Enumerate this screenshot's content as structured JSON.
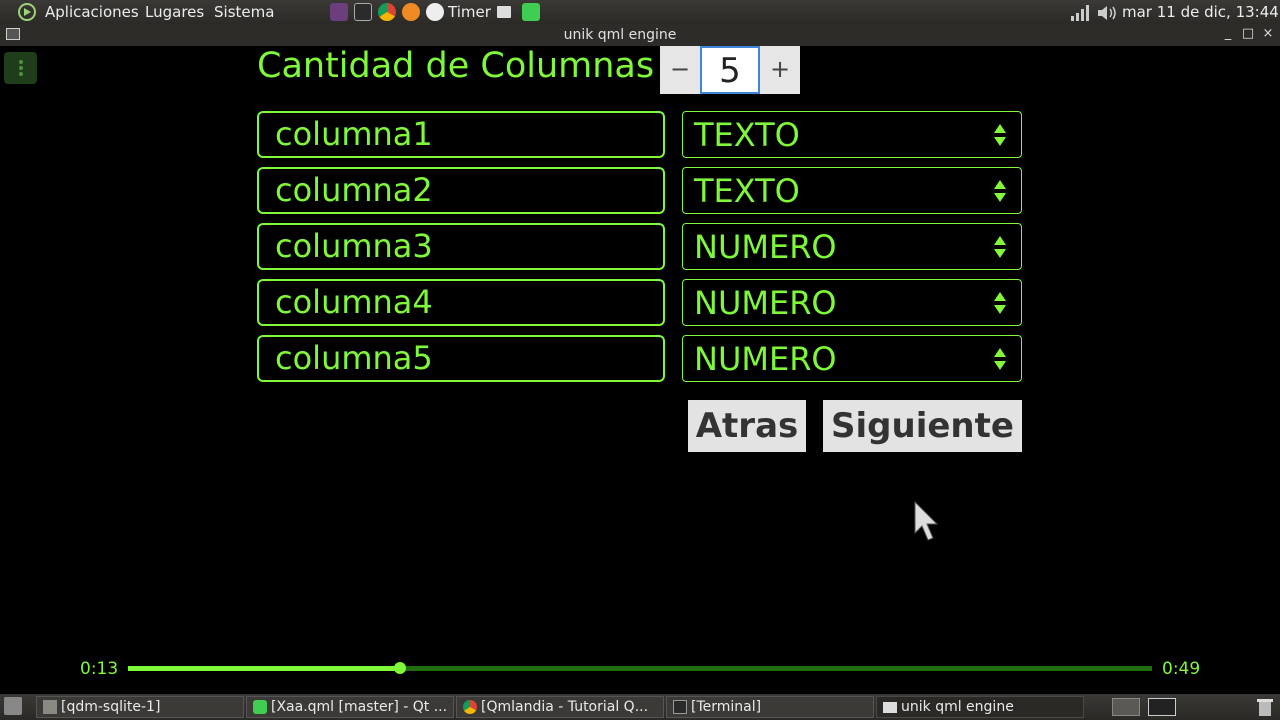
{
  "top_panel": {
    "menus": [
      "Aplicaciones",
      "Lugares",
      "Sistema"
    ],
    "timer_label": "Timer",
    "clock": "mar 11 de dic, 13:44"
  },
  "window": {
    "title": "unik qml engine"
  },
  "form": {
    "heading": "Cantidad de Columnas",
    "count": {
      "minus": "−",
      "value": "5",
      "plus": "+"
    },
    "rows": [
      {
        "name": "columna1",
        "type": "TEXTO"
      },
      {
        "name": "columna2",
        "type": "TEXTO"
      },
      {
        "name": "columna3",
        "type": "NUMERO"
      },
      {
        "name": "columna4",
        "type": "NUMERO"
      },
      {
        "name": "columna5",
        "type": "NUMERO"
      }
    ],
    "back_label": "Atras",
    "next_label": "Siguiente"
  },
  "player": {
    "elapsed": "0:13",
    "total": "0:49",
    "progress": 0.2656,
    "accent": "#7ff83a"
  },
  "taskbar": {
    "tasks": [
      {
        "label": "[qdm-sqlite-1]",
        "icon": "folder-icon"
      },
      {
        "label": "[Xaa.qml [master] - Qt ...",
        "icon": "qt-creator-icon"
      },
      {
        "label": "[Qmlandia - Tutorial Q...",
        "icon": "chrome-icon"
      },
      {
        "label": "[Terminal]",
        "icon": "terminal-icon"
      },
      {
        "label": "unik qml engine",
        "icon": "window-icon"
      }
    ]
  }
}
